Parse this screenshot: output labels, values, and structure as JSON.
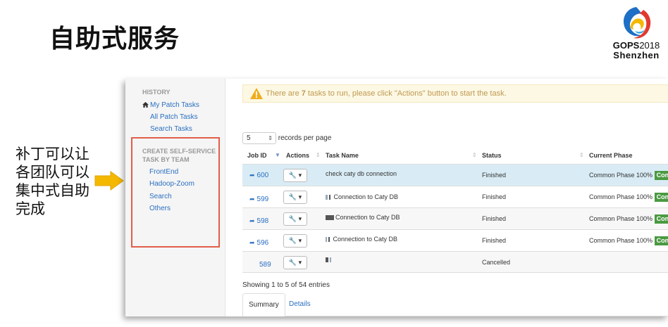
{
  "slide": {
    "title": "自助式服务",
    "side_text_lines": [
      "补丁可以让",
      "各团队可以",
      "集中式自助",
      "完成"
    ]
  },
  "logo": {
    "brand": "GOPS",
    "year": "2018",
    "city": "Shenzhen"
  },
  "sidebar": {
    "history_header": "HISTORY",
    "my_patch_tasks": "My Patch Tasks",
    "all_patch_tasks": "All Patch Tasks",
    "search_tasks": "Search Tasks",
    "create_header": "CREATE SELF-SERVICE TASK BY TEAM",
    "teams": [
      "FrontEnd",
      "Hadoop-Zoom",
      "Search",
      "Others"
    ]
  },
  "alert": {
    "prefix": "There are ",
    "count": "7",
    "suffix": " tasks to run, please click \"Actions\" button to start the task."
  },
  "per_page": {
    "value": "5",
    "label": "records per page"
  },
  "table": {
    "headers": {
      "job_id": "Job ID",
      "actions": "Actions",
      "task_name": "Task Name",
      "status": "Status",
      "phase": "Current Phase"
    },
    "rows": [
      {
        "job_id": "600",
        "task_name": "check caty db connection",
        "status": "Finished",
        "phase": "Common Phase 100%",
        "badge": "Con"
      },
      {
        "job_id": "599",
        "task_name": "Connection to Caty DB",
        "status": "Finished",
        "phase": "Common Phase 100%",
        "badge": "Con"
      },
      {
        "job_id": "598",
        "task_name": "Connection to Caty DB",
        "status": "Finished",
        "phase": "Common Phase 100%",
        "badge": "Con"
      },
      {
        "job_id": "596",
        "task_name": "Connection to Caty DB",
        "status": "Finished",
        "phase": "Common Phase 100%",
        "badge": "Con"
      },
      {
        "job_id": "589",
        "task_name": "",
        "status": "Cancelled",
        "phase": "",
        "badge": ""
      }
    ]
  },
  "footer": {
    "showing": "Showing 1 to 5 of 54 entries",
    "tabs": [
      "Summary",
      "Details"
    ]
  },
  "colors": {
    "accent_link": "#2a6fc0",
    "highlight_box": "#e25d4a",
    "badge": "#4a9a41",
    "arrow": "#f5b800"
  }
}
